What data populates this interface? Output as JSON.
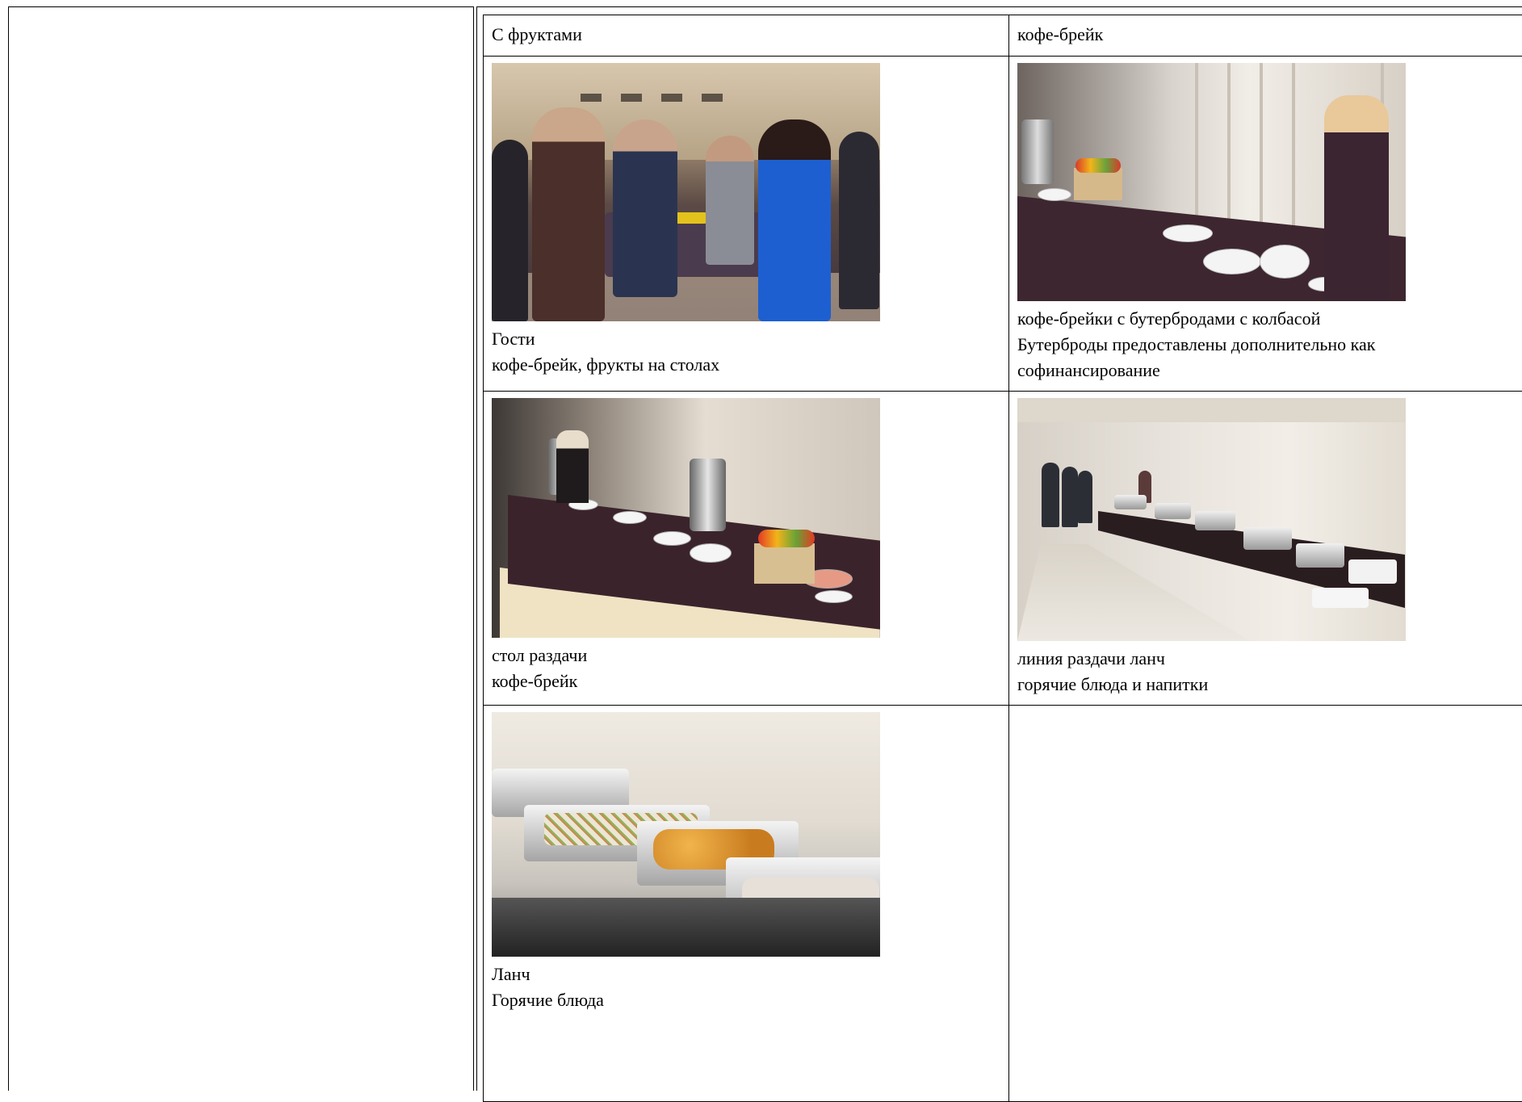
{
  "table": {
    "header": {
      "left": "С фруктами",
      "right": "кофе-брейк"
    },
    "rows": [
      {
        "left": {
          "photo": "guests-at-tables-photo",
          "lines": [
            "Гости",
            "кофе-брейк, фрукты на столах"
          ]
        },
        "right": {
          "photo": "buffet-with-server-photo",
          "lines": [
            "кофе-брейки с бутербродами с колбасой",
            "Бутерброды предоставлены дополнительно как",
            "софинансирование"
          ]
        }
      },
      {
        "left": {
          "photo": "serving-table-photo",
          "lines": [
            "стол раздачи",
            "кофе-брейк"
          ]
        },
        "right": {
          "photo": "lunch-line-photo",
          "lines": [
            "линия раздачи ланч",
            "горячие блюда и напитки"
          ]
        }
      },
      {
        "left": {
          "photo": "hot-dishes-photo",
          "lines": [
            "Ланч",
            "Горячие блюда"
          ]
        },
        "right": {
          "photo": "",
          "lines": []
        }
      }
    ]
  }
}
